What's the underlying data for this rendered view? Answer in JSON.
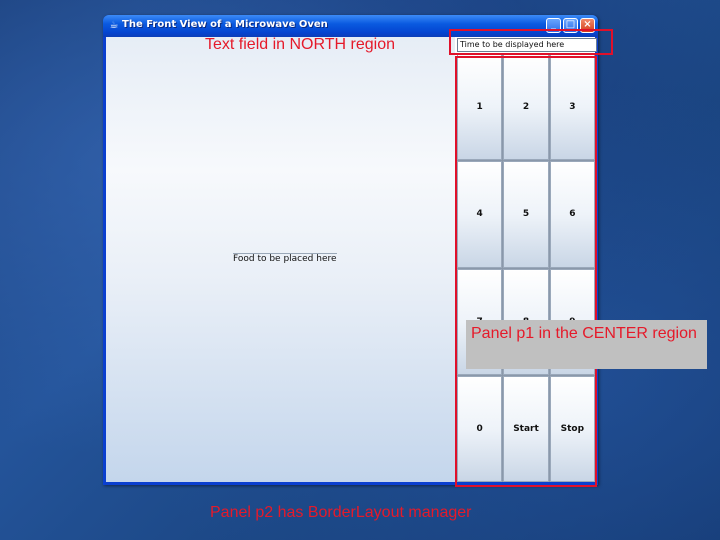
{
  "window": {
    "title": "The Front View of a Microwave Oven",
    "icon": "java-cup-icon",
    "buttons": {
      "minimize": "_",
      "maximize": "□",
      "close": "×"
    }
  },
  "food_area": {
    "label": "Food to be placed here"
  },
  "time_field": {
    "value": "Time to be displayed here"
  },
  "keypad": {
    "keys": [
      "1",
      "2",
      "3",
      "4",
      "5",
      "6",
      "7",
      "8",
      "9",
      "0",
      "Start",
      "Stop"
    ]
  },
  "annotations": {
    "north": "Text field in NORTH region",
    "center": "Panel p1 in the CENTER region",
    "bottom": "Panel p2 has BorderLayout manager"
  },
  "colors": {
    "annotation_red": "#e51a2a",
    "titlebar_blue": "#0a5ae0",
    "slide_background": "#1f4a8a"
  }
}
